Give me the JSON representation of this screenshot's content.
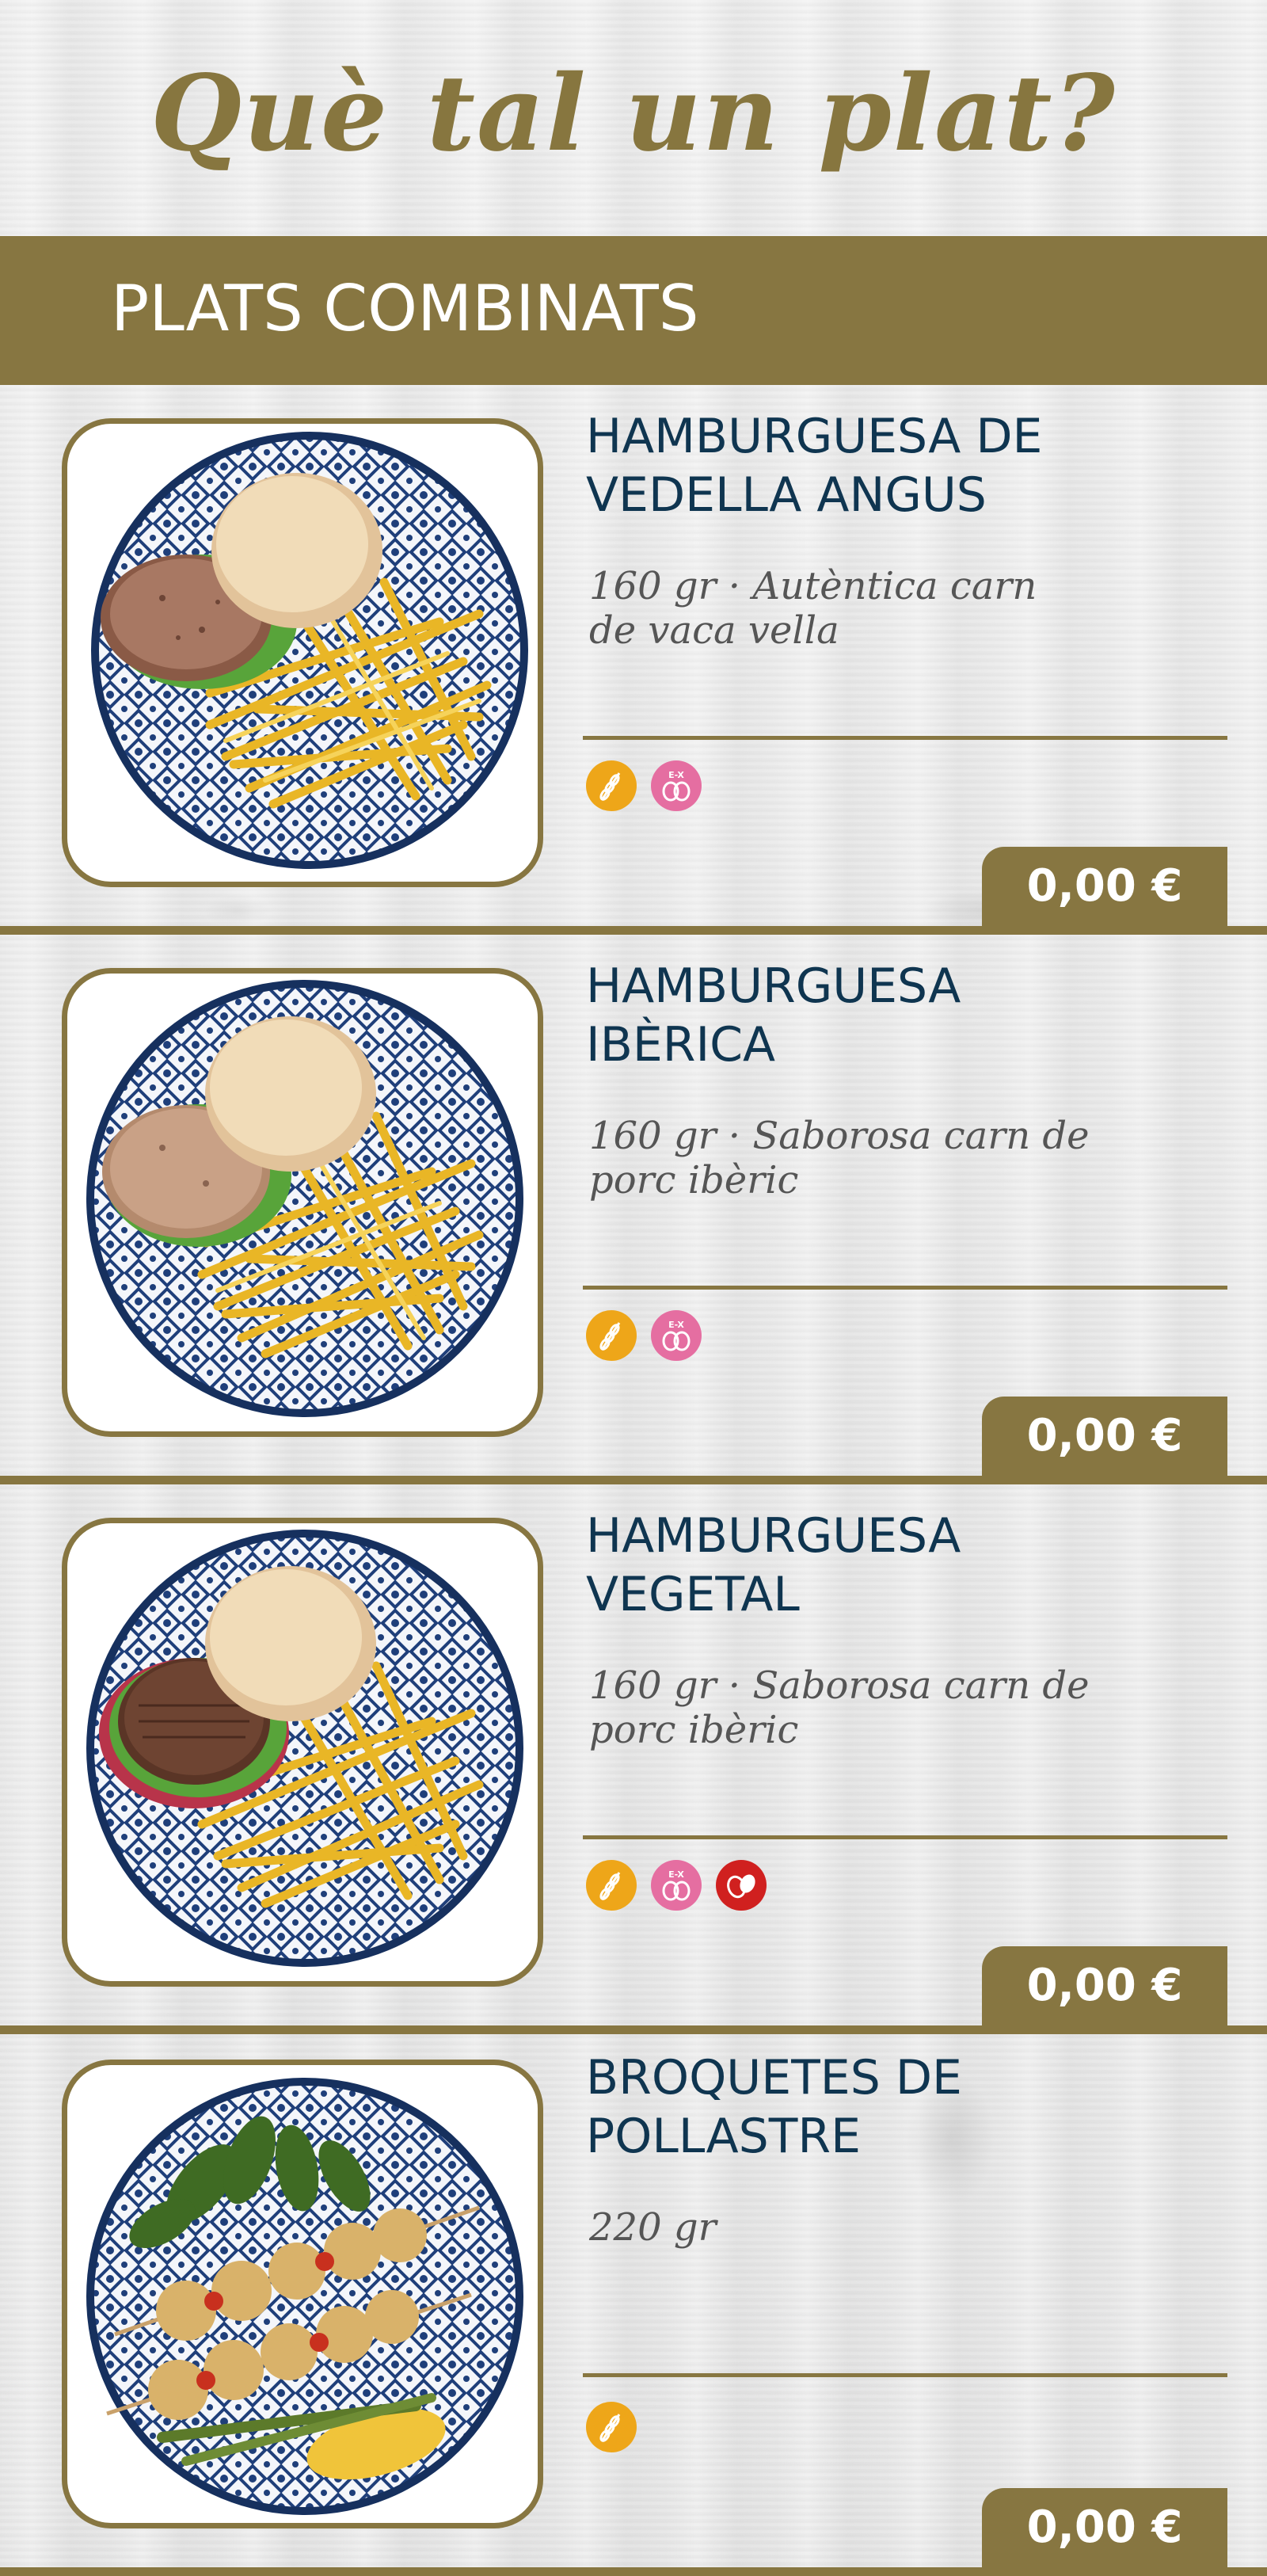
{
  "page": {
    "title": "Què tal un plat?",
    "section": "PLATS COMBINATS",
    "accent_color": "#877641",
    "name_color": "#0f3550"
  },
  "items": [
    {
      "name_line1": "HAMBURGUESA DE",
      "name_line2": "VEDELLA ANGUS",
      "desc_line1": "160 gr  · Autèntica carn",
      "desc_line2": "de vaca vella",
      "price": "0,00 €",
      "photo": "burger-fries-plate",
      "allergens": [
        "gluten-icon",
        "egg-icon"
      ]
    },
    {
      "name_line1": "HAMBURGUESA",
      "name_line2": "IBÈRICA",
      "desc_line1": "160 gr  · Saborosa carn de",
      "desc_line2": "porc ibèric",
      "price": "0,00 €",
      "photo": "burger-fries-plate",
      "allergens": [
        "gluten-icon",
        "egg-icon"
      ]
    },
    {
      "name_line1": "HAMBURGUESA",
      "name_line2": "VEGETAL",
      "desc_line1": "160 gr  · Saborosa carn de",
      "desc_line2": "porc ibèric",
      "price": "0,00 €",
      "photo": "veggie-burger-fries-plate",
      "allergens": [
        "gluten-icon",
        "egg-icon",
        "nuts-icon"
      ]
    },
    {
      "name_line1": "BROQUETES DE",
      "name_line2": "POLLASTRE",
      "desc_line1": "220 gr",
      "desc_line2": "",
      "price": "0,00 €",
      "photo": "chicken-skewers-plate",
      "allergens": [
        "gluten-icon"
      ]
    }
  ]
}
